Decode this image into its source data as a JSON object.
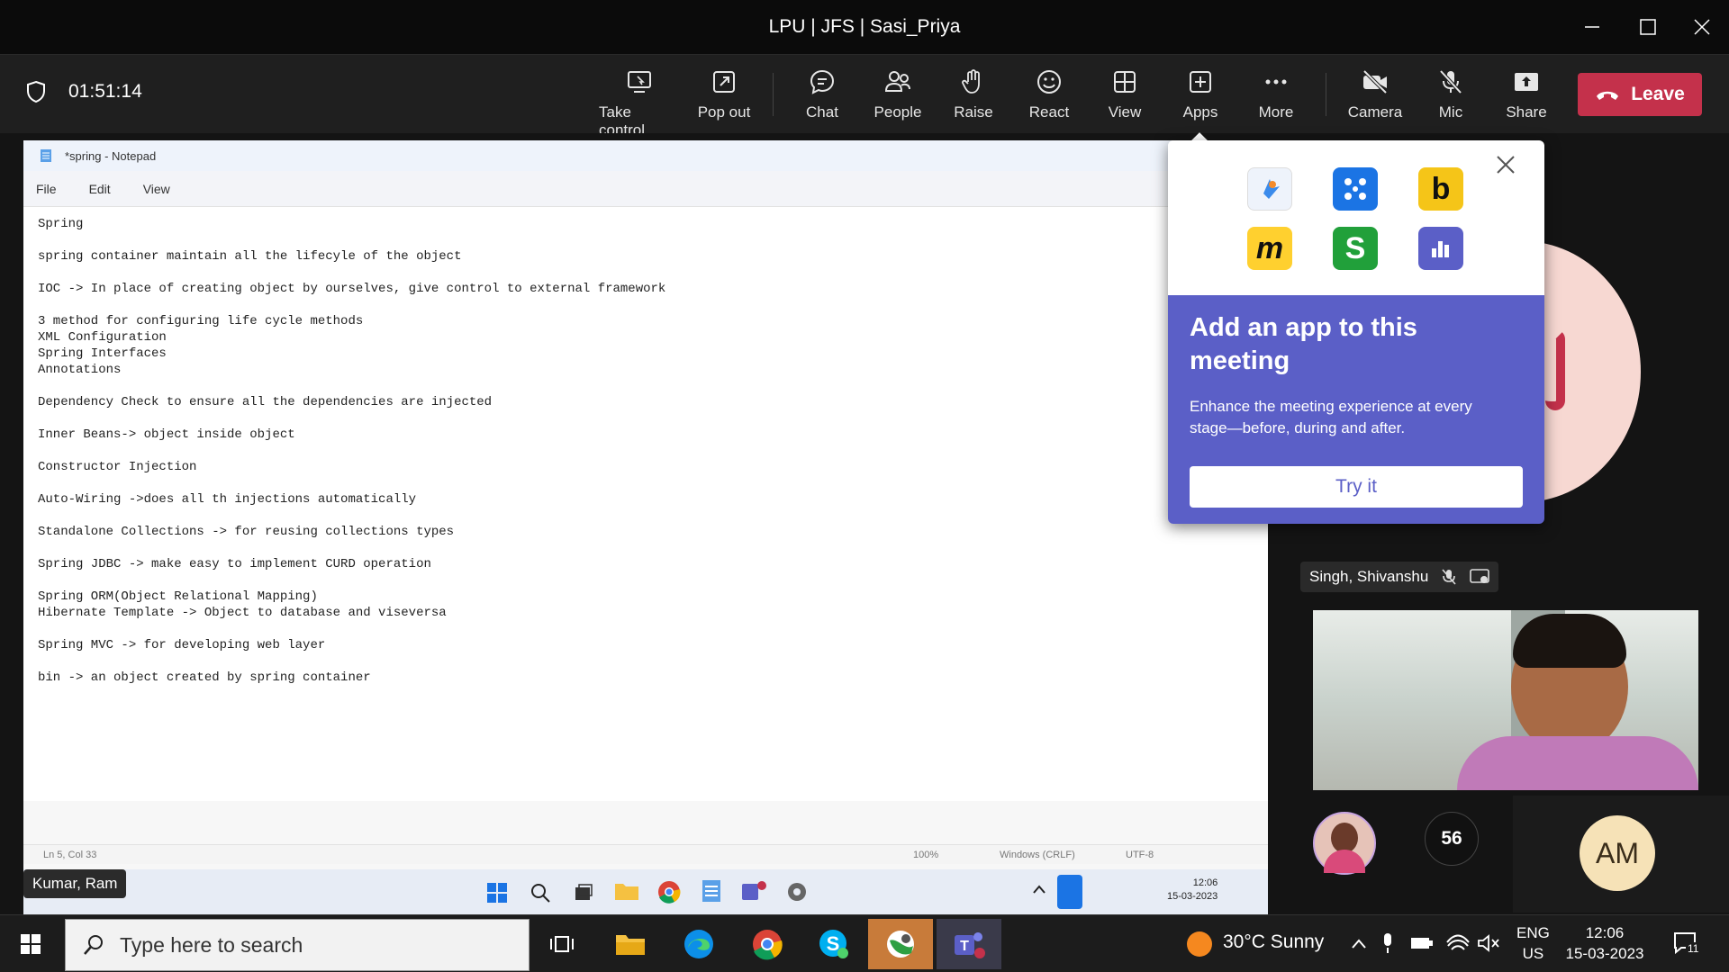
{
  "window": {
    "title": "LPU | JFS | Sasi_Priya"
  },
  "toolbar": {
    "timer": "01:51:14",
    "buttons": {
      "take_control": "Take control",
      "pop_out": "Pop out",
      "chat": "Chat",
      "people": "People",
      "raise": "Raise",
      "react": "React",
      "view": "View",
      "apps": "Apps",
      "more": "More",
      "camera": "Camera",
      "mic": "Mic",
      "share": "Share"
    },
    "leave_label": "Leave",
    "accent_color": "#c4314b"
  },
  "notepad": {
    "title": "*spring - Notepad",
    "menu": [
      "File",
      "Edit",
      "View"
    ],
    "lines": [
      "Spring",
      "",
      "spring container maintain all the lifecyle of the object",
      "",
      "IOC -> In place of creating object by ourselves, give control to external framework",
      "",
      "3 method for configuring life cycle methods",
      "XML Configuration",
      "Spring Interfaces",
      "Annotations",
      "",
      "Dependency Check to ensure all the dependencies are injected",
      "",
      "Inner Beans-> object inside object",
      "",
      "Constructor Injection",
      "",
      "Auto-Wiring ->does all th injections automatically",
      "",
      "Standalone Collections -> for reusing collections types",
      "",
      "Spring JDBC -> make easy to implement CURD operation",
      "",
      "Spring ORM(Object Relational Mapping)",
      "Hibernate Template -> Object to database and viseversa",
      "",
      "Spring MVC -> for developing web layer",
      "",
      "bin -> an object created by spring container"
    ],
    "status": {
      "position": "Ln 5, Col 33",
      "zoom": "100%",
      "line_ending": "Windows (CRLF)",
      "encoding": "UTF-8"
    },
    "inner_clock": {
      "time": "12:06",
      "date": "15-03-2023"
    }
  },
  "presenter_name": "Kumar, Ram",
  "apps_popup": {
    "heading": "Add an app to this meeting",
    "description": "Enhance the meeting experience at every stage—before, during and after.",
    "button": "Try it",
    "accent_color": "#5b5fc7",
    "apps": [
      {
        "icon": "polly-app-icon",
        "color": "#eef3fb"
      },
      {
        "icon": "connect-app-icon",
        "color": "#1b74e4"
      },
      {
        "icon": "b-app-icon",
        "color": "#f5c518",
        "glyph": "b"
      },
      {
        "icon": "miro-app-icon",
        "color": "#ffd02f",
        "glyph": "m"
      },
      {
        "icon": "s-app-icon",
        "color": "#21a03a",
        "glyph": "S"
      },
      {
        "icon": "poll-app-icon",
        "color": "#5b5fc7"
      }
    ]
  },
  "participant": {
    "name": "Singh, Shivanshu"
  },
  "participant_count": "56",
  "avatar_initials": "AM",
  "taskbar": {
    "search_placeholder": "Type here to search",
    "weather": "30°C  Sunny",
    "lang": "ENG",
    "region": "US",
    "time": "12:06",
    "date": "15-03-2023",
    "notification_count": "11"
  }
}
